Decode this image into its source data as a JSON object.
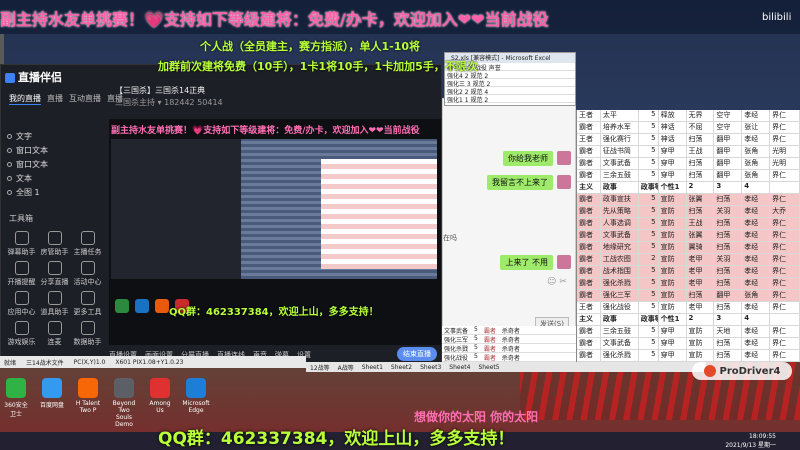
{
  "banner": {
    "text": "副主持水友单挑赛！💗支持如下等级建将：免费/办卡，欢迎加入❤❤当前战役",
    "line1": "个人战（全员建主，赛方指派），单人1-10将",
    "line2": "加群前次建将免费（10手），1卡1将10手，1卡加加5手，不限次",
    "corner": "bilibili"
  },
  "stream_app": {
    "title": "直播伴侣",
    "tabs": [
      "我的直播",
      "直播",
      "互动直播",
      "直播"
    ],
    "room_title": "【三国杀】三国杀14正典",
    "room_meta": "三国杀主持 ▾   182442   50414",
    "scenes": [
      "文字",
      "窗口文本",
      "窗口文本",
      "文本",
      "全图 1"
    ],
    "toolbox_label": "工具箱",
    "tools": [
      "弹幕助手",
      "房管助手",
      "主播任务",
      "开播提醒",
      "分享直播",
      "活动中心",
      "应用中心",
      "道具助手",
      "更多工具",
      "游戏娱乐",
      "连麦",
      "数据助手"
    ],
    "preview_banner": "副主持水友单挑赛！💗支持如下等级建将：免费/办卡，欢迎加入❤❤当前战役",
    "preview_overlay": "QQ群：462337384，欢迎上山，多多支持！",
    "bottom": [
      "直播设置",
      "画面设置",
      "分屏直播",
      "直播连线",
      "声音",
      "弹幕",
      "设置"
    ],
    "start_label": "结束直播"
  },
  "chat": {
    "bubble1": "你给我老师",
    "bubble2": "我留言不上来了",
    "bubble3": "上来了 不用",
    "side_text": "在吗",
    "icons": "☺  ✂",
    "send": "发送(S)"
  },
  "excel_small": {
    "title": "S2.xls [兼容模式] - Microsoft Excel",
    "rows": [
      "编号 姓名 战役 声誉",
      "强化4 2 规范 2",
      "强化三 3 规范 2",
      "强化2 2 规范 4",
      "强化1 1 规范 2"
    ]
  },
  "sheet": {
    "rows": [
      {
        "cells": [
          "王者",
          "太平",
          "5",
          "释放",
          "无界",
          "空守",
          "孝经",
          "界仁"
        ],
        "hl": false
      },
      {
        "cells": [
          "霸者",
          "培养水军",
          "5",
          "神话",
          "不屈",
          "空守",
          "张让",
          "界仁"
        ],
        "hl": false
      },
      {
        "cells": [
          "王者",
          "强化赛行",
          "5",
          "神话",
          "扫荡",
          "翻甲",
          "孝经",
          "界仁"
        ],
        "hl": false
      },
      {
        "cells": [
          "霸者",
          "征战书简",
          "5",
          "穿甲",
          "王战",
          "翻甲",
          "张角",
          "光明"
        ],
        "hl": false
      },
      {
        "cells": [
          "霸者",
          "文事武备",
          "5",
          "穿甲",
          "扫荡",
          "翻甲",
          "张角",
          "光明"
        ],
        "hl": false
      },
      {
        "cells": [
          "霸者",
          "三余五鼓",
          "5",
          "穿甲",
          "扫荡",
          "翻甲",
          "张角",
          "界仁"
        ],
        "hl": false
      },
      {
        "cells": [
          "主义",
          "政事",
          "政事等级",
          "个性1",
          "2",
          "3",
          "4",
          ""
        ],
        "hl": false
      },
      {
        "cells": [
          "霸者",
          "政事宣扶",
          "5",
          "宣防",
          "张翼",
          "扫荡",
          "孝经",
          "界仁"
        ],
        "hl": true
      },
      {
        "cells": [
          "霸者",
          "先从策略",
          "5",
          "宣防",
          "扫荡",
          "关羽",
          "孝经",
          "大乔"
        ],
        "hl": true
      },
      {
        "cells": [
          "霸者",
          "人事选调",
          "5",
          "宣防",
          "王战",
          "扫荡",
          "孝经",
          "界仁"
        ],
        "hl": true
      },
      {
        "cells": [
          "霸者",
          "文事武备",
          "5",
          "宣防",
          "张翼",
          "扫荡",
          "孝经",
          "界仁"
        ],
        "hl": true
      },
      {
        "cells": [
          "霸者",
          "地缘研究",
          "5",
          "宣防",
          "翼骑",
          "扫荡",
          "孝经",
          "界仁"
        ],
        "hl": true
      },
      {
        "cells": [
          "霸者",
          "工战农图",
          "2",
          "宣防",
          "老甲",
          "关羽",
          "孝经",
          "界仁"
        ],
        "hl": true
      },
      {
        "cells": [
          "霸者",
          "战术指围",
          "5",
          "宣防",
          "老甲",
          "扫荡",
          "孝经",
          "界仁"
        ],
        "hl": true
      },
      {
        "cells": [
          "霸者",
          "强化杀戮",
          "5",
          "宣防",
          "老甲",
          "扫荡",
          "孝经",
          "界仁"
        ],
        "hl": true
      },
      {
        "cells": [
          "霸者",
          "强化三军",
          "5",
          "宣防",
          "扫荡",
          "翻甲",
          "张角",
          "界仁"
        ],
        "hl": true
      },
      {
        "cells": [
          "王者",
          "强化战役",
          "5",
          "宣防",
          "老甲",
          "扫荡",
          "孝经",
          "界仁"
        ],
        "hl": false
      },
      {
        "cells": [
          "主义",
          "政事",
          "政事等级",
          "个性1",
          "2",
          "3",
          "4",
          ""
        ],
        "hl": false
      },
      {
        "cells": [
          "霸者",
          "三余五鼓",
          "5",
          "穿甲",
          "宣防",
          "天地",
          "孝经",
          "界仁"
        ],
        "hl": false
      },
      {
        "cells": [
          "霸者",
          "文事武备",
          "5",
          "穿甲",
          "宣防",
          "扫荡",
          "孝经",
          "界仁"
        ],
        "hl": false
      },
      {
        "cells": [
          "霸者",
          "强化杀戮",
          "5",
          "穿甲",
          "宣防",
          "扫荡",
          "孝经",
          "界仁"
        ],
        "hl": false
      }
    ]
  },
  "sheet_left": {
    "rows": [
      [
        "文事武备",
        "5",
        "霸者",
        "杀奇者"
      ],
      [
        "强化三军",
        "5",
        "霸者",
        "杀奇者"
      ],
      [
        "强化杀戮",
        "5",
        "霸者",
        "杀奇者"
      ],
      [
        "强化战役",
        "5",
        "霸者",
        "杀奇者"
      ]
    ]
  },
  "sheet_tabs": [
    "12战等",
    "A战等",
    "Sheet1",
    "Sheet2",
    "Sheet3",
    "Sheet4",
    "Sheet5"
  ],
  "statusbar": [
    "就绪",
    "三14战术文件",
    "PC(X,Y)1.0",
    "X601 PIX1.08+Y1.0.23"
  ],
  "probe": "ProDriver4",
  "desktop_icons": [
    "360安全卫士",
    "百度网盘",
    "H Talent Two P",
    "Beyond Two Souls Demo",
    "Among Us",
    "Microsoft Edge"
  ],
  "song": "想做你的太阳 你的太阳",
  "qq_text": "QQ群：462337384，欢迎上山，多多支持！",
  "clock": {
    "time": "18:09:55",
    "date": "2021/9/13 星期一"
  },
  "colors": {
    "accent": "#3b82f6",
    "pink": "#ff6eb3",
    "lime": "#b8ff3a",
    "row_highlight": "#f4c6c6"
  }
}
